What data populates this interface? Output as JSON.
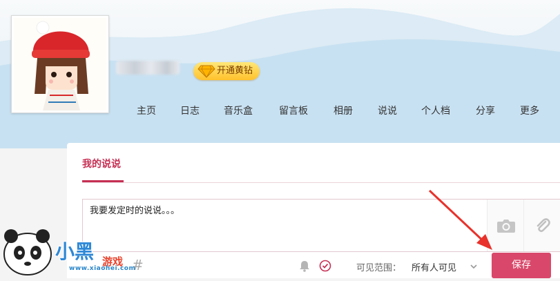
{
  "profile": {
    "vip_label": "开通黄钻"
  },
  "nav": {
    "items": [
      {
        "label": "主页"
      },
      {
        "label": "日志"
      },
      {
        "label": "音乐盒"
      },
      {
        "label": "留言板"
      },
      {
        "label": "相册"
      },
      {
        "label": "说说"
      },
      {
        "label": "个人档"
      },
      {
        "label": "分享"
      },
      {
        "label": "更多"
      }
    ]
  },
  "panel": {
    "tab_label": "我的说说",
    "composer_text": "我要发定时的说说。。。",
    "tools": [
      "camera-icon",
      "attachment-icon"
    ],
    "footer": {
      "hash_symbol": "#",
      "scope_label": "可见范围：",
      "scope_value": "所有人可见",
      "save_label": "保存"
    }
  },
  "watermark": {
    "brand_main": "小黑",
    "brand_sub": "游戏",
    "url": "www.xiaohei.com"
  },
  "colors": {
    "accent": "#c62f53",
    "save_button": "#d9486a",
    "vip_gold": "#ffc22b",
    "banner_blue": "#cfe3f1",
    "arrow_red": "#e8322b"
  }
}
